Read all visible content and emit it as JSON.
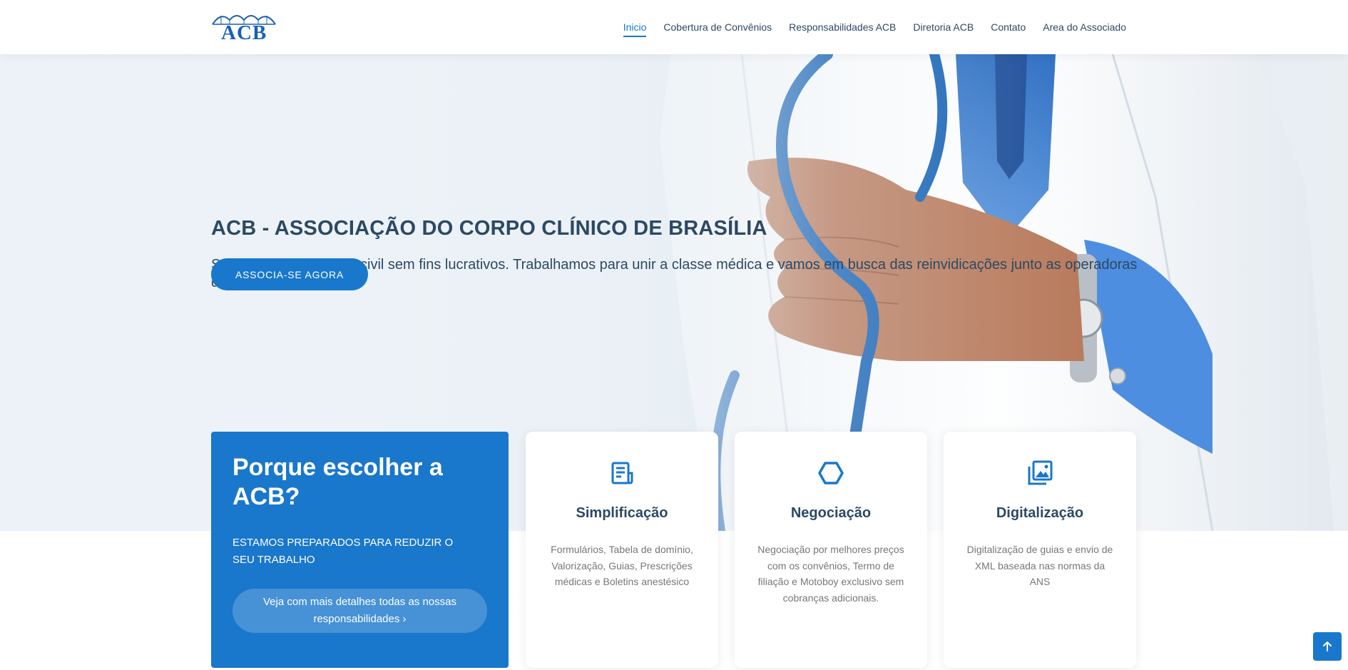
{
  "header": {
    "logo_text": "ACB",
    "nav": [
      {
        "label": "Inicio",
        "active": true
      },
      {
        "label": "Cobertura de Convênios",
        "active": false
      },
      {
        "label": "Responsabilidades ACB",
        "active": false
      },
      {
        "label": "Diretoria ACB",
        "active": false
      },
      {
        "label": "Contato",
        "active": false
      },
      {
        "label": "Area do Associado",
        "active": false
      }
    ]
  },
  "hero": {
    "title": "ACB - ASSOCIAÇÃO DO CORPO CLÍNICO DE BRASÍLIA",
    "subtitle": "Somos uma sociedade civil sem fins lucrativos. Trabalhamos para unir a classe médica e vamos em busca das reinvidicações junto as operadoras de saúde",
    "cta_label": "ASSOCIA-SE AGORA"
  },
  "why": {
    "title": "Porque escolher a ACB?",
    "text": "ESTAMOS PREPARADOS PARA REDUZIR O SEU TRABALHO",
    "button_label": "Veja com mais detalhes todas as nossas responsabilidades ›"
  },
  "cards": [
    {
      "icon": "receipt-icon",
      "title": "Simplificação",
      "text": "Formulários, Tabela de domínio, Valorização, Guias, Prescrições médicas e Boletins anestésico"
    },
    {
      "icon": "hexagon-icon",
      "title": "Negociação",
      "text": "Negociação por melhores preços com os convênios, Termo de filiação e Motoboy exclusivo sem cobranças adicionais."
    },
    {
      "icon": "images-icon",
      "title": "Digitalização",
      "text": "Digitalização de guias e envio de XML baseada nas normas da ANS"
    }
  ],
  "colors": {
    "accent": "#1977cc",
    "heading": "#2c4964",
    "muted": "#777777"
  }
}
